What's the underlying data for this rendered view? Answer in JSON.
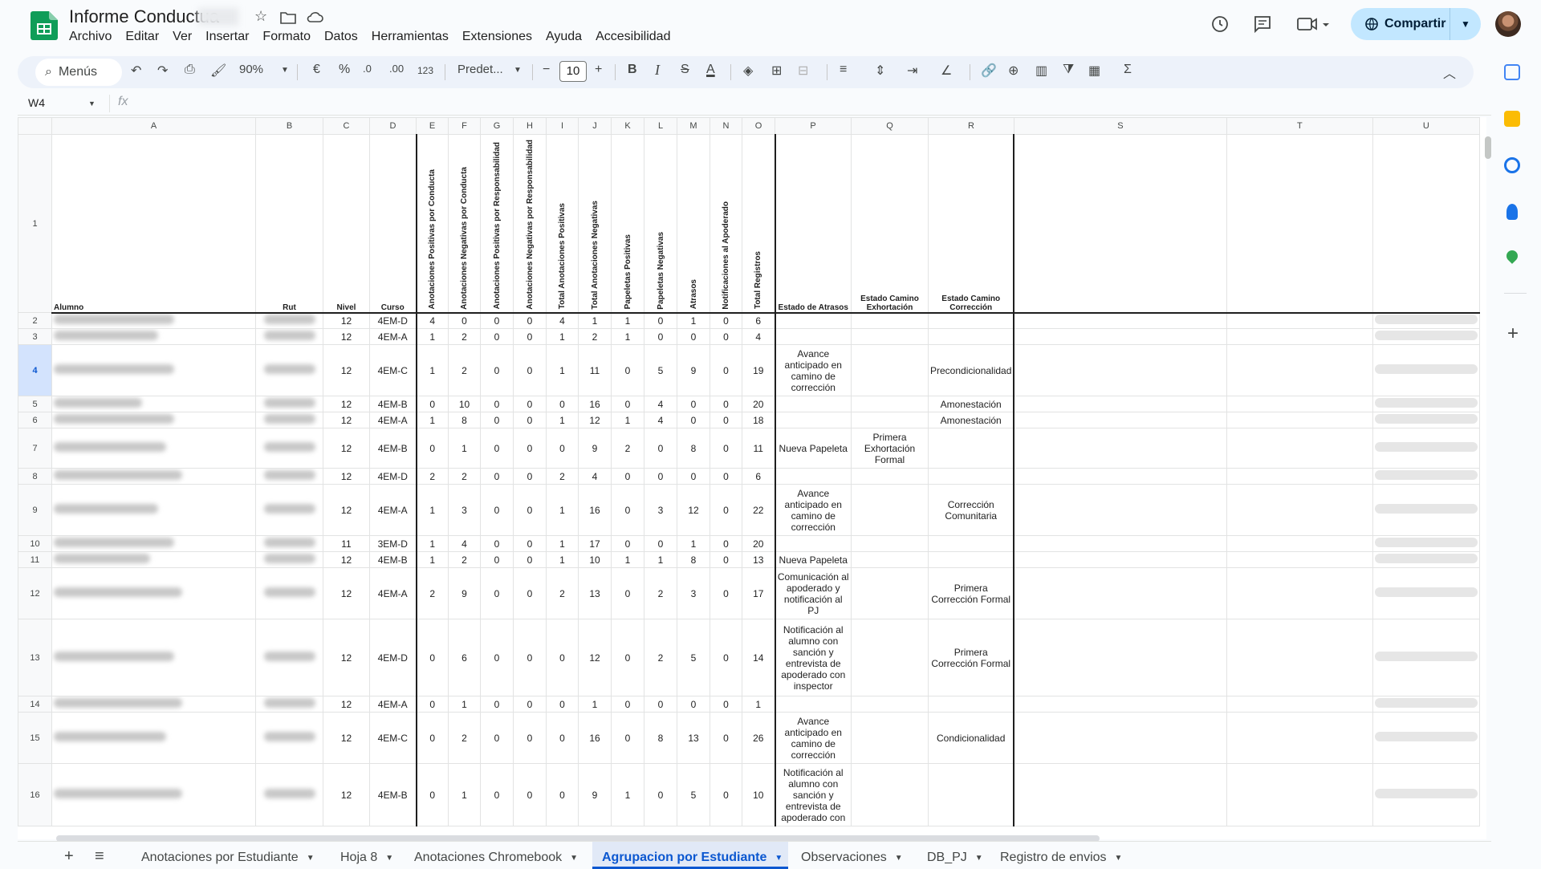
{
  "title": "Informe Conductua",
  "menu": [
    "Archivo",
    "Editar",
    "Ver",
    "Insertar",
    "Formato",
    "Datos",
    "Herramientas",
    "Extensiones",
    "Ayuda",
    "Accesibilidad"
  ],
  "share_label": "Compartir",
  "toolbar": {
    "search": "Menús",
    "zoom": "90%",
    "currency": "€",
    "percent": "%",
    "dec_less": ".0",
    "dec_more": ".00",
    "number_format": "123",
    "font": "Predet...",
    "font_size": "10"
  },
  "namebox": "W4",
  "fx": "fx",
  "columns": [
    "A",
    "B",
    "C",
    "D",
    "E",
    "F",
    "G",
    "H",
    "I",
    "J",
    "K",
    "L",
    "M",
    "N",
    "O",
    "P",
    "Q",
    "R",
    "S",
    "T",
    "U"
  ],
  "headers": {
    "A": "Alumno",
    "B": "Rut",
    "C": "Nivel",
    "D": "Curso",
    "E": "Anotaciones Positivas por Conducta",
    "F": "Anotaciones Negativas por Conducta",
    "G": "Anotaciones Positivas por Responsabilidad",
    "H": "Anotaciones Negativas por Responsabilidad",
    "I": "Total Anotaciones Positivas",
    "J": "Total Anotaciones Negativas",
    "K": "Papeletas Positivas",
    "L": "Papeletas Negativas",
    "M": "Atrasos",
    "N": "Notificaciones al Apoderado",
    "O": "Total Registros",
    "P": "Estado de Atrasos",
    "Q": "Estado Camino Exhortación",
    "R": "Estado Camino Corrección"
  },
  "rows": [
    {
      "n": "2",
      "nivel": "12",
      "curso": "4EM-D",
      "v": [
        "4",
        "0",
        "0",
        "0",
        "4",
        "1",
        "1",
        "0",
        "1",
        "0",
        "6"
      ],
      "p": "",
      "q": "",
      "r": ""
    },
    {
      "n": "3",
      "nivel": "12",
      "curso": "4EM-A",
      "v": [
        "1",
        "2",
        "0",
        "0",
        "1",
        "2",
        "1",
        "0",
        "0",
        "0",
        "4"
      ],
      "p": "",
      "q": "",
      "r": ""
    },
    {
      "n": "4",
      "nivel": "12",
      "curso": "4EM-C",
      "v": [
        "1",
        "2",
        "0",
        "0",
        "1",
        "11",
        "0",
        "5",
        "9",
        "0",
        "19"
      ],
      "p": "Avance anticipado en camino de corrección",
      "q": "",
      "r": "Precondicionalidad"
    },
    {
      "n": "5",
      "nivel": "12",
      "curso": "4EM-B",
      "v": [
        "0",
        "10",
        "0",
        "0",
        "0",
        "16",
        "0",
        "4",
        "0",
        "0",
        "20"
      ],
      "p": "",
      "q": "",
      "r": "Amonestación"
    },
    {
      "n": "6",
      "nivel": "12",
      "curso": "4EM-A",
      "v": [
        "1",
        "8",
        "0",
        "0",
        "1",
        "12",
        "1",
        "4",
        "0",
        "0",
        "18"
      ],
      "p": "",
      "q": "",
      "r": "Amonestación"
    },
    {
      "n": "7",
      "nivel": "12",
      "curso": "4EM-B",
      "v": [
        "0",
        "1",
        "0",
        "0",
        "0",
        "9",
        "2",
        "0",
        "8",
        "0",
        "11"
      ],
      "p": "Nueva Papeleta",
      "q": "Primera Exhortación Formal",
      "r": ""
    },
    {
      "n": "8",
      "nivel": "12",
      "curso": "4EM-D",
      "v": [
        "2",
        "2",
        "0",
        "0",
        "2",
        "4",
        "0",
        "0",
        "0",
        "0",
        "6"
      ],
      "p": "",
      "q": "",
      "r": ""
    },
    {
      "n": "9",
      "nivel": "12",
      "curso": "4EM-A",
      "v": [
        "1",
        "3",
        "0",
        "0",
        "1",
        "16",
        "0",
        "3",
        "12",
        "0",
        "22"
      ],
      "p": "Avance anticipado en camino de corrección",
      "q": "",
      "r": "Corrección Comunitaria"
    },
    {
      "n": "10",
      "nivel": "11",
      "curso": "3EM-D",
      "v": [
        "1",
        "4",
        "0",
        "0",
        "1",
        "17",
        "0",
        "0",
        "1",
        "0",
        "20"
      ],
      "p": "",
      "q": "",
      "r": ""
    },
    {
      "n": "11",
      "nivel": "12",
      "curso": "4EM-B",
      "v": [
        "1",
        "2",
        "0",
        "0",
        "1",
        "10",
        "1",
        "1",
        "8",
        "0",
        "13"
      ],
      "p": "Nueva Papeleta",
      "q": "",
      "r": ""
    },
    {
      "n": "12",
      "nivel": "12",
      "curso": "4EM-A",
      "v": [
        "2",
        "9",
        "0",
        "0",
        "2",
        "13",
        "0",
        "2",
        "3",
        "0",
        "17"
      ],
      "p": "Comunicación al apoderado y notificación al PJ",
      "q": "",
      "r": "Primera Corrección Formal"
    },
    {
      "n": "13",
      "nivel": "12",
      "curso": "4EM-D",
      "v": [
        "0",
        "6",
        "0",
        "0",
        "0",
        "12",
        "0",
        "2",
        "5",
        "0",
        "14"
      ],
      "p": "Notificación al alumno con sanción y entrevista de apoderado con inspector",
      "q": "",
      "r": "Primera Corrección Formal"
    },
    {
      "n": "14",
      "nivel": "12",
      "curso": "4EM-A",
      "v": [
        "0",
        "1",
        "0",
        "0",
        "0",
        "1",
        "0",
        "0",
        "0",
        "0",
        "1"
      ],
      "p": "",
      "q": "",
      "r": ""
    },
    {
      "n": "15",
      "nivel": "12",
      "curso": "4EM-C",
      "v": [
        "0",
        "2",
        "0",
        "0",
        "0",
        "16",
        "0",
        "8",
        "13",
        "0",
        "26"
      ],
      "p": "Avance anticipado en camino de corrección",
      "q": "",
      "r": "Condicionalidad"
    },
    {
      "n": "16",
      "nivel": "12",
      "curso": "4EM-B",
      "v": [
        "0",
        "1",
        "0",
        "0",
        "0",
        "9",
        "1",
        "0",
        "5",
        "0",
        "10"
      ],
      "p": "Notificación al alumno con sanción y entrevista de apoderado con",
      "q": "",
      "r": ""
    }
  ],
  "tabs": [
    "Anotaciones por Estudiante",
    "Hoja 8",
    "Anotaciones Chromebook",
    "Agrupacion por Estudiante",
    "Observaciones",
    "DB_PJ",
    "Registro de envios"
  ],
  "active_tab": "Agrupacion por Estudiante",
  "colors": {
    "accent": "#0b57d0",
    "share_bg": "#c2e7ff",
    "toolbar_bg": "#edf2fa",
    "sheets_green": "#0f9d58"
  }
}
